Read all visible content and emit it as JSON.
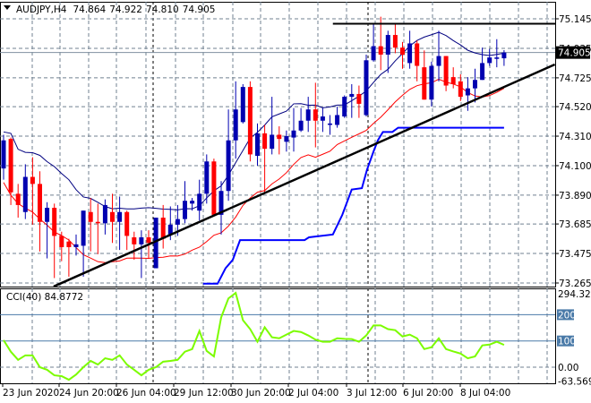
{
  "header": {
    "symbol": "AUDJPY,H4",
    "open": "74.864",
    "high": "74.922",
    "low": "74.810",
    "close": "74.905"
  },
  "colors": {
    "bull": "#0000b0",
    "bear": "#ff0000",
    "upper_band": "#000080",
    "lower_band": "#ff0000",
    "step_line": "#0000ff",
    "trend": "#000000",
    "cci": "#7cfc00",
    "level": "#4a7aa8",
    "grid": "#708090"
  },
  "chart_data": [
    {
      "type": "candlestick",
      "title": "AUDJPY,H4",
      "y_ticks": [
        "75.145",
        "74.935",
        "74.725",
        "74.520",
        "74.310",
        "74.100",
        "73.890",
        "73.685",
        "73.475",
        "73.265"
      ],
      "ylim": [
        73.265,
        75.145
      ],
      "x_labels": [
        "23 Jun 2020",
        "24 Jun 20:00",
        "26 Jun 04:00",
        "29 Jun 12:00",
        "30 Jun 20:00",
        "2 Jul 04:00",
        "3 Jul 12:00",
        "6 Jul 20:00",
        "8 Jul 04:00"
      ],
      "current_price": "74.905",
      "ohlc": [
        [
          74.08,
          74.32,
          74.0,
          74.28
        ],
        [
          74.29,
          74.3,
          73.82,
          73.91
        ],
        [
          73.9,
          73.97,
          73.73,
          73.82
        ],
        [
          73.77,
          74.11,
          73.72,
          74.02
        ],
        [
          74.02,
          74.16,
          73.68,
          73.97
        ],
        [
          73.97,
          74.06,
          73.49,
          73.7
        ],
        [
          73.7,
          73.84,
          73.44,
          73.8
        ],
        [
          73.8,
          73.83,
          73.3,
          73.6
        ],
        [
          73.6,
          73.63,
          73.42,
          73.52
        ],
        [
          73.56,
          73.58,
          73.31,
          73.52
        ],
        [
          73.52,
          73.61,
          73.46,
          73.54
        ],
        [
          73.53,
          73.78,
          73.31,
          73.78
        ],
        [
          73.77,
          73.87,
          73.49,
          73.7
        ],
        [
          73.7,
          73.83,
          73.47,
          73.69
        ],
        [
          73.69,
          73.86,
          73.61,
          73.82
        ],
        [
          73.77,
          73.9,
          73.55,
          73.7
        ],
        [
          73.7,
          73.88,
          73.5,
          73.77
        ],
        [
          73.77,
          73.78,
          73.5,
          73.6
        ],
        [
          73.59,
          73.63,
          73.43,
          73.54
        ],
        [
          73.54,
          73.64,
          73.3,
          73.59
        ],
        [
          73.59,
          73.64,
          73.44,
          73.55
        ],
        [
          73.37,
          73.73,
          73.37,
          73.73
        ],
        [
          73.73,
          73.82,
          73.51,
          73.58
        ],
        [
          73.61,
          73.81,
          73.57,
          73.68
        ],
        [
          73.68,
          73.82,
          73.6,
          73.72
        ],
        [
          73.72,
          73.99,
          73.69,
          73.85
        ],
        [
          73.83,
          73.87,
          73.78,
          73.85
        ],
        [
          73.78,
          74.0,
          73.71,
          73.9
        ],
        [
          73.9,
          74.18,
          73.83,
          74.13
        ],
        [
          74.13,
          74.15,
          73.75,
          73.75
        ],
        [
          73.75,
          73.99,
          73.61,
          73.92
        ],
        [
          73.92,
          74.5,
          73.85,
          74.28
        ],
        [
          74.28,
          74.7,
          74.15,
          74.5
        ],
        [
          74.41,
          74.68,
          74.4,
          74.66
        ],
        [
          74.66,
          74.7,
          74.13,
          74.18
        ],
        [
          74.17,
          74.4,
          74.1,
          74.33
        ],
        [
          74.33,
          74.39,
          73.9,
          74.22
        ],
        [
          74.22,
          74.59,
          74.18,
          74.32
        ],
        [
          74.32,
          74.38,
          74.18,
          74.29
        ],
        [
          74.27,
          74.35,
          74.2,
          74.31
        ],
        [
          74.3,
          74.51,
          74.2,
          74.35
        ],
        [
          74.35,
          74.51,
          74.34,
          74.42
        ],
        [
          74.42,
          74.59,
          74.34,
          74.5
        ],
        [
          74.5,
          74.69,
          74.23,
          74.42
        ],
        [
          74.42,
          74.51,
          74.34,
          74.45
        ],
        [
          74.39,
          74.46,
          74.32,
          74.4
        ],
        [
          74.39,
          74.52,
          74.37,
          74.46
        ],
        [
          74.45,
          74.6,
          74.44,
          74.59
        ],
        [
          74.59,
          74.68,
          74.44,
          74.61
        ],
        [
          74.61,
          74.67,
          74.44,
          74.54
        ],
        [
          74.46,
          74.89,
          74.45,
          74.85
        ],
        [
          74.85,
          75.11,
          74.84,
          74.95
        ],
        [
          74.95,
          75.16,
          74.78,
          74.89
        ],
        [
          74.89,
          75.06,
          74.76,
          75.03
        ],
        [
          75.03,
          75.11,
          74.9,
          74.94
        ],
        [
          74.94,
          74.98,
          74.79,
          74.89
        ],
        [
          74.83,
          75.06,
          74.79,
          74.97
        ],
        [
          74.97,
          74.99,
          74.7,
          74.81
        ],
        [
          74.8,
          74.92,
          74.57,
          74.57
        ],
        [
          74.57,
          74.84,
          74.52,
          74.81
        ],
        [
          74.81,
          75.06,
          74.7,
          74.88
        ],
        [
          74.88,
          74.88,
          74.63,
          74.67
        ],
        [
          74.73,
          74.8,
          74.65,
          74.68
        ],
        [
          74.7,
          74.75,
          74.56,
          74.59
        ],
        [
          74.6,
          74.73,
          74.49,
          74.65
        ],
        [
          74.65,
          74.79,
          74.55,
          74.71
        ],
        [
          74.71,
          74.94,
          74.71,
          74.83
        ],
        [
          74.83,
          74.93,
          74.81,
          74.87
        ],
        [
          74.86,
          75.0,
          74.8,
          74.87
        ],
        [
          74.864,
          74.922,
          74.81,
          74.905
        ]
      ],
      "step_line": [
        [
          27.5,
          73.26
        ],
        [
          29.5,
          73.26
        ],
        [
          30.6,
          73.37
        ],
        [
          31.6,
          73.43
        ],
        [
          32.6,
          73.57
        ],
        [
          41.5,
          73.57
        ],
        [
          42.1,
          73.59
        ],
        [
          45.4,
          73.61
        ],
        [
          46.7,
          73.75
        ],
        [
          48.0,
          73.93
        ],
        [
          49.4,
          73.94
        ],
        [
          50.1,
          74.07
        ],
        [
          51.0,
          74.2
        ],
        [
          51.6,
          74.28
        ],
        [
          52.3,
          74.34
        ],
        [
          53.6,
          74.34
        ],
        [
          54.4,
          74.37
        ],
        [
          69.0,
          74.37
        ]
      ],
      "trendline": [
        [
          6.9,
          73.24
        ],
        [
          76.0,
          74.82
        ]
      ],
      "resistance_line": {
        "price": 75.11,
        "from_index": 45.4,
        "to_index": 76.0
      }
    },
    {
      "type": "line",
      "title": "CCI(40) 84.8772",
      "name": "CCI(40)",
      "last_value": "84.8772",
      "y_ticks": [
        "294.3207",
        "200",
        "100",
        "0.00",
        "-63.5692"
      ],
      "ylim": [
        -63.5692,
        294.3207
      ],
      "levels": [
        200,
        100,
        0
      ],
      "values": [
        103,
        59,
        28,
        45,
        45,
        0,
        -10,
        -31,
        -34,
        -48,
        -28,
        0,
        24,
        10,
        34,
        28,
        45,
        10,
        -10,
        -31,
        -10,
        0,
        21,
        24,
        28,
        59,
        69,
        138,
        62,
        41,
        190,
        262,
        283,
        179,
        145,
        97,
        152,
        114,
        110,
        124,
        138,
        134,
        121,
        105,
        97,
        97,
        110,
        108,
        107,
        97,
        121,
        159,
        159,
        145,
        141,
        117,
        124,
        110,
        69,
        76,
        110,
        69,
        60,
        52,
        34,
        41,
        83,
        86,
        97,
        84.88
      ]
    }
  ]
}
